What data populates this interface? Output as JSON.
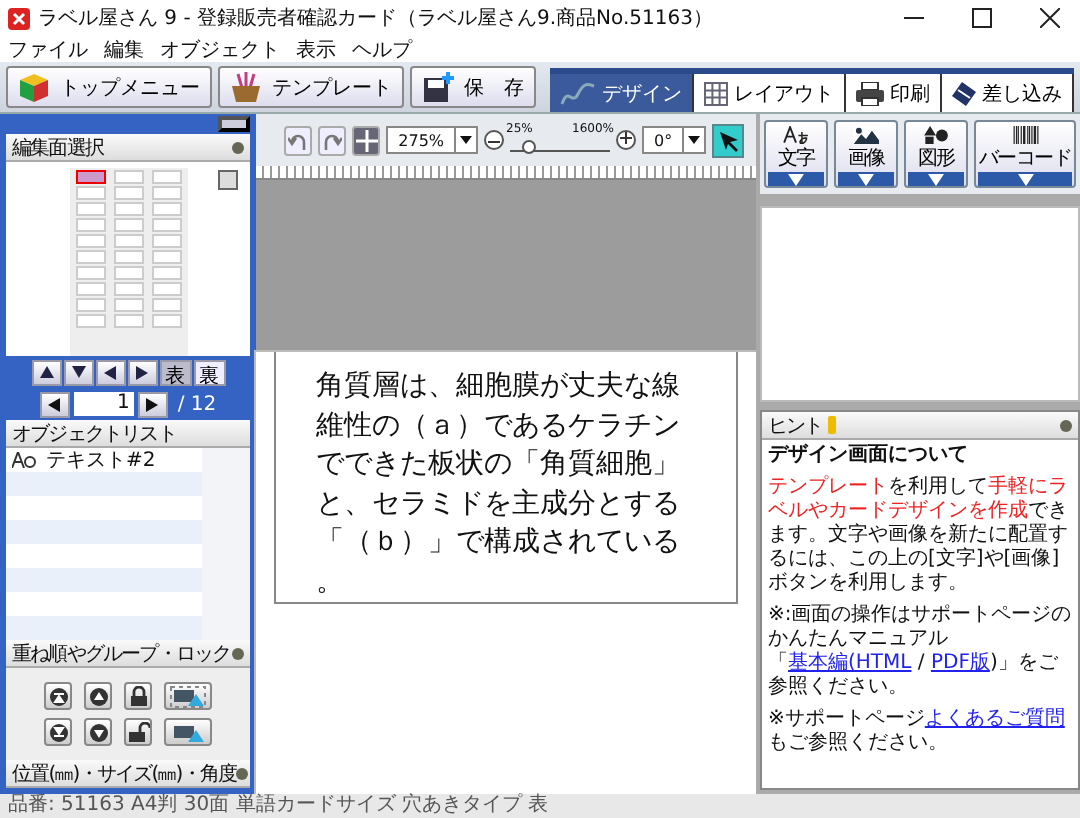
{
  "window": {
    "title": "ラベル屋さん 9 - 登録販売者確認カード（ラベル屋さん9.商品No.51163）"
  },
  "menu": [
    "ファイル",
    "編集",
    "オブジェクト",
    "表示",
    "ヘルプ"
  ],
  "toolbar": [
    {
      "label": "トップメニュー",
      "kind": "home"
    },
    {
      "label": "テンプレート",
      "kind": "template"
    },
    {
      "label": "保　存",
      "kind": "save"
    }
  ],
  "mode_tabs": [
    {
      "label": "デザイン",
      "kind": "design",
      "selected": true
    },
    {
      "label": "レイアウト",
      "kind": "layout",
      "selected": false
    },
    {
      "label": "印刷",
      "kind": "print",
      "selected": false
    },
    {
      "label": "差し込み",
      "kind": "merge",
      "selected": false
    }
  ],
  "face_select": {
    "title": "編集面選択",
    "thumbnails": [
      {
        "selected": true
      },
      {
        "selected": false
      },
      {
        "selected": false
      },
      {
        "selected": false
      },
      {
        "selected": false
      },
      {
        "selected": false
      },
      {
        "selected": false
      },
      {
        "selected": false
      },
      {
        "selected": false
      },
      {
        "selected": false
      },
      {
        "selected": false
      },
      {
        "selected": false
      },
      {
        "selected": false
      },
      {
        "selected": false
      },
      {
        "selected": false
      },
      {
        "selected": false
      },
      {
        "selected": false
      },
      {
        "selected": false
      },
      {
        "selected": false
      },
      {
        "selected": false
      },
      {
        "selected": false
      },
      {
        "selected": false
      },
      {
        "selected": false
      },
      {
        "selected": false
      },
      {
        "selected": false
      },
      {
        "selected": false
      },
      {
        "selected": false
      },
      {
        "selected": false
      },
      {
        "selected": false
      },
      {
        "selected": false
      }
    ],
    "sides": [
      {
        "label": "表",
        "selected": true
      },
      {
        "label": "裏",
        "selected": false
      }
    ],
    "page": "1",
    "page_total": "/ 12"
  },
  "object_list": {
    "title": "オブジェクトリスト",
    "items": [
      {
        "label": "テキスト#2"
      }
    ]
  },
  "arrange": {
    "title": "重ね順やグループ・ロック"
  },
  "position": {
    "title": "位置(㎜)・サイズ(㎜)・角度"
  },
  "view_toolbar": {
    "zoom": "275%",
    "zoom_min": "25%",
    "zoom_max": "1600%",
    "zoom_slider": {
      "level": 0.2
    },
    "rotation": "0°"
  },
  "tools": [
    {
      "label": "文字",
      "kind": "text"
    },
    {
      "label": "画像",
      "kind": "image"
    },
    {
      "label": "図形",
      "kind": "shape"
    },
    {
      "label": "バーコード",
      "kind": "barcode"
    }
  ],
  "canvas": {
    "text": "角質層は、細胞膜が丈夫な線維性の（ａ）であるケラチンでできた板状の「角質細胞」と、セラミドを主成分とする「（ｂ）」で構成されている。"
  },
  "hint": {
    "title": "ヒント",
    "heading": "デザイン画面について",
    "paragraphs": [
      [
        {
          "text": "テンプレート",
          "kind": "red"
        },
        {
          "text": "を利用して",
          "kind": "plain"
        },
        {
          "text": "手軽にラベルやカードデザインを作成",
          "kind": "red"
        },
        {
          "text": "できます。文字や画像を新たに配置するには、この上の[文字]や[画像]ボタンを利用します。",
          "kind": "plain"
        }
      ],
      [
        {
          "text": "※:画面の操作はサポートページのかんたんマニュアル「",
          "kind": "plain"
        },
        {
          "text": "基本編(HTML",
          "kind": "link"
        },
        {
          "text": " / ",
          "kind": "plain"
        },
        {
          "text": "PDF版",
          "kind": "link"
        },
        {
          "text": ")」をご参照ください。",
          "kind": "plain"
        }
      ],
      [
        {
          "text": "※サポートページ",
          "kind": "plain"
        },
        {
          "text": "よくあるご質問",
          "kind": "link"
        },
        {
          "text": "もご参照ください。",
          "kind": "plain"
        }
      ]
    ]
  },
  "status_bar": "品番: 51163 A4判 30面 単語カードサイズ 穴あきタイプ 表"
}
